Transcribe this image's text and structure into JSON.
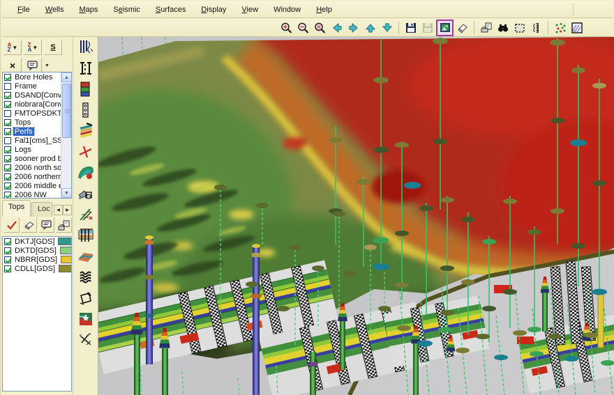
{
  "menu_bar": {
    "items": [
      {
        "pre": "",
        "accel": "F",
        "post": "ile"
      },
      {
        "pre": "",
        "accel": "W",
        "post": "ells"
      },
      {
        "pre": "",
        "accel": "M",
        "post": "aps"
      },
      {
        "pre": "S",
        "accel": "e",
        "post": "ismic"
      },
      {
        "pre": "",
        "accel": "S",
        "post": "urfaces"
      },
      {
        "pre": "",
        "accel": "D",
        "post": "isplay"
      },
      {
        "pre": "",
        "accel": "V",
        "post": "iew"
      },
      {
        "pre": "",
        "accel": "",
        "post": "Window"
      },
      {
        "pre": "",
        "accel": "H",
        "post": "elp"
      }
    ]
  },
  "toolbar": {
    "button_names": [
      "zoom-in",
      "zoom-out",
      "zoom-area",
      "pan-left",
      "pan-right",
      "pan-up",
      "pan-down",
      "save",
      "save-copy",
      "capture-image",
      "erase",
      "export-view",
      "find-well",
      "select-area",
      "vertical-scale",
      "well-symbols",
      "backdrop"
    ]
  },
  "sidebar": {
    "top_tools": {
      "az_top": "A",
      "az_bottom": "Z",
      "za_top": "Z",
      "za_bottom": "A",
      "s_label": "S",
      "delete_glyph": "×",
      "arrow_down": "▼",
      "spin_left": "◀",
      "spin_right": "▶",
      "scroll_up": "▲",
      "scroll_down": "▼"
    },
    "layers": {
      "items": [
        {
          "label": "Bore Holes",
          "checked": true,
          "selected": false
        },
        {
          "label": "Frame",
          "checked": false,
          "selected": false
        },
        {
          "label": "DSAND[Conv",
          "checked": true,
          "selected": false
        },
        {
          "label": "niobrara[Conv",
          "checked": true,
          "selected": false
        },
        {
          "label": "FMTOPSDKT",
          "checked": false,
          "selected": false
        },
        {
          "label": "Tops",
          "checked": true,
          "selected": false
        },
        {
          "label": "Perfs",
          "checked": true,
          "selected": true
        },
        {
          "label": "Fal1[cms]_SS",
          "checked": false,
          "selected": false
        },
        {
          "label": "Logs",
          "checked": true,
          "selected": false
        },
        {
          "label": "sooner prod b",
          "checked": true,
          "selected": false
        },
        {
          "label": "2006 north so",
          "checked": true,
          "selected": false
        },
        {
          "label": "2006 northern",
          "checked": true,
          "selected": false
        },
        {
          "label": "2006 middle e",
          "checked": true,
          "selected": false
        },
        {
          "label": "2006 NW",
          "checked": true,
          "selected": false
        }
      ]
    },
    "tabs": {
      "tops": "Tops",
      "loc": "Loc"
    },
    "tops": {
      "items": [
        {
          "label": "DKTJ[GDS]",
          "checked": true,
          "color": "#2e9a8c"
        },
        {
          "label": "DKTD[GDS]",
          "checked": true,
          "color": "#8cd07e"
        },
        {
          "label": "NBRR[GDS]",
          "checked": true,
          "color": "#eec42e",
          "color2": "#2e9a8c"
        },
        {
          "label": "CDLL[GDS]",
          "checked": true,
          "color": "#8d8d2a"
        }
      ]
    },
    "strip_tool_names": [
      "well-log-curves",
      "cross-section",
      "color-fill-blocks",
      "wellbore-display",
      "layer-stack-edit",
      "correlation-pick",
      "contour-map",
      "fill-export",
      "angle-picks",
      "fence-diagram",
      "surface-3d",
      "hatch-pattern",
      "polygon-draw",
      "basemap-star",
      "crossplot-picks"
    ]
  },
  "colors": {
    "selection": "#316ac5",
    "well_green": "#2fc468",
    "surface_red": "#b02a1c",
    "surface_green": "#5a8a3c",
    "toolbar_arrow": "#45b0c0"
  }
}
